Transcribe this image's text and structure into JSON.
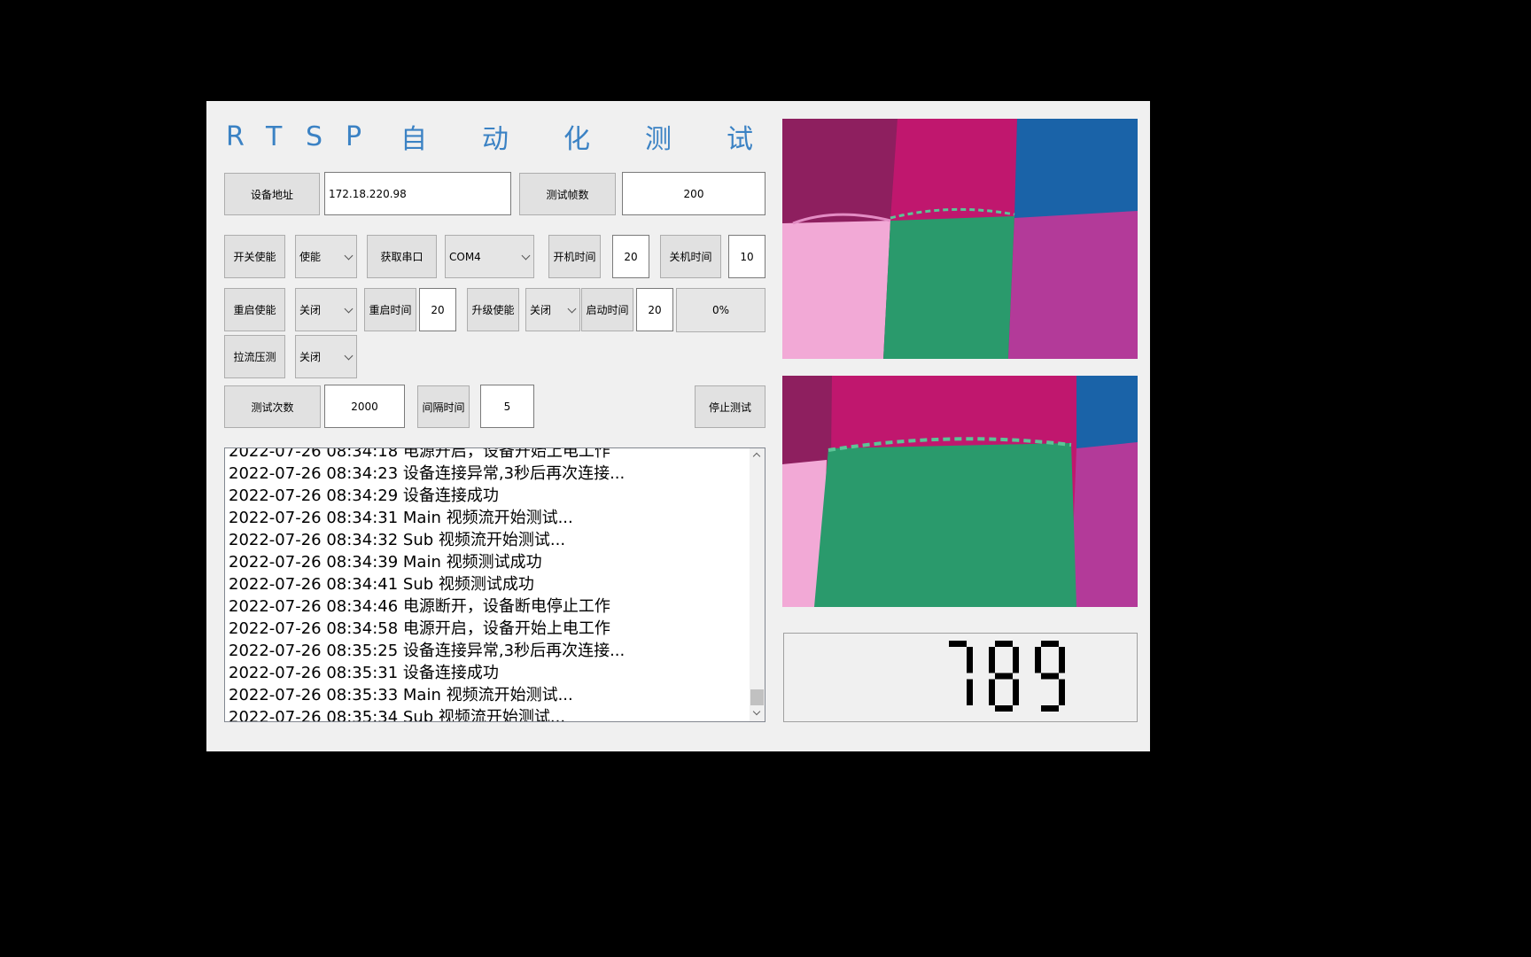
{
  "app": {
    "title_chars": [
      "R",
      "T",
      "S",
      "P",
      "自",
      "动",
      "化",
      "测",
      "试"
    ]
  },
  "row1": {
    "device_addr_label": "设备地址",
    "device_addr_value": "172.18.220.98",
    "frames_label": "测试帧数",
    "frames_value": "200"
  },
  "row2": {
    "power_enable_label": "开关使能",
    "power_enable_value": "使能",
    "get_port_label": "获取串口",
    "port_value": "COM4",
    "on_time_label": "开机时间",
    "on_time_value": "20",
    "off_time_label": "关机时间",
    "off_time_value": "10"
  },
  "row3": {
    "reboot_enable_label": "重启使能",
    "reboot_enable_value": "关闭",
    "reboot_time_label": "重启时间",
    "reboot_time_value": "20",
    "upgrade_enable_label": "升级使能",
    "upgrade_enable_value": "关闭",
    "start_time_label": "启动时间",
    "start_time_value": "20",
    "progress_text": "0%"
  },
  "row4": {
    "stream_stress_label": "拉流压测",
    "stream_stress_value": "关闭"
  },
  "row5": {
    "test_count_label": "测试次数",
    "test_count_value": "2000",
    "interval_label": "间隔时间",
    "interval_value": "5",
    "stop_label": "停止测试"
  },
  "log": {
    "partial_top": "2022-07-26 08:34:18 电源开启，设备开始上电工作",
    "lines": [
      "2022-07-26 08:34:23 设备连接异常,3秒后再次连接...",
      "2022-07-26 08:34:29 设备连接成功",
      "2022-07-26 08:34:31 Main 视频流开始测试...",
      "2022-07-26 08:34:32 Sub 视频流开始测试...",
      "2022-07-26 08:34:39 Main 视频测试成功",
      "2022-07-26 08:34:41 Sub  视频测试成功",
      "2022-07-26 08:34:46 电源断开，设备断电停止工作",
      "2022-07-26 08:34:58 电源开启，设备开始上电工作",
      "2022-07-26 08:35:25 设备连接异常,3秒后再次连接...",
      "2022-07-26 08:35:31 设备连接成功",
      "2022-07-26 08:35:33 Main 视频流开始测试...",
      "2022-07-26 08:35:34 Sub 视频流开始测试..."
    ]
  },
  "counter": {
    "value": "789"
  },
  "colors": {
    "title": "#3b82c4",
    "cloth_magenta": "#c0176e",
    "cloth_blue": "#1a63a8",
    "cloth_green": "#2a9a6c",
    "cloth_pink": "#f2a9d6",
    "cloth_purple": "#b33a99",
    "cloth_maroon": "#8e1f5f"
  }
}
